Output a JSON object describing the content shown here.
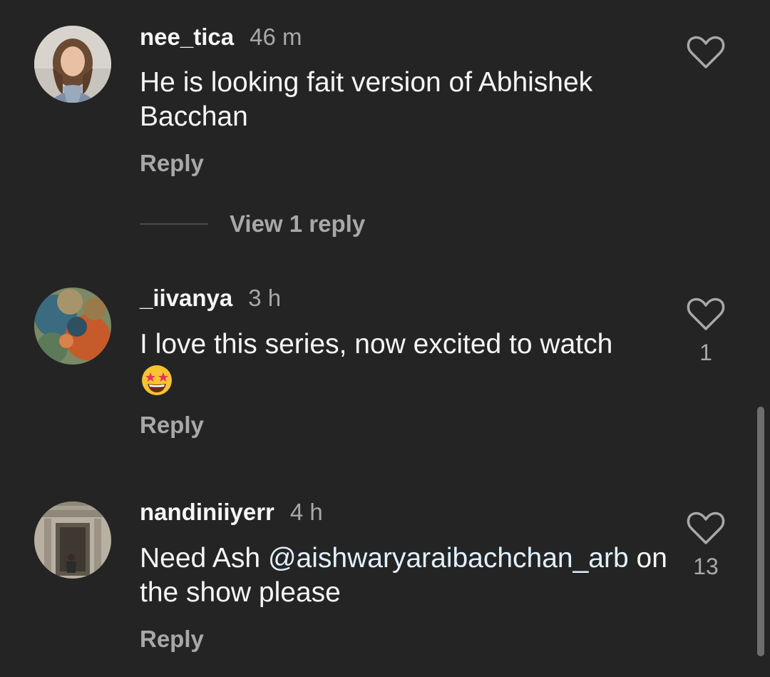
{
  "comments": [
    {
      "username": "nee_tica",
      "time": "46 m",
      "text": "He is looking fait version of Abhishek Bacchan",
      "reply_label": "Reply",
      "view_replies_label": "View 1 reply",
      "like_count": ""
    },
    {
      "username": "_iivanya",
      "time": "3 h",
      "text": "I love this series, now excited to watch",
      "reply_label": "Reply",
      "like_count": "1"
    },
    {
      "username": "nandiniiyerr",
      "time": "4 h",
      "text_before": "Need Ash ",
      "mention": "@aishwaryaraibachchan_arb",
      "text_after": " on the show please",
      "reply_label": "Reply",
      "like_count": "13"
    }
  ],
  "icons": {
    "like": "heart-outline-icon",
    "emoji": "star-struck-emoji"
  },
  "colors": {
    "background": "#242424",
    "primary_text": "#f5f5f5",
    "secondary_text": "#a8a8a8",
    "mention": "#e0f1ff"
  }
}
